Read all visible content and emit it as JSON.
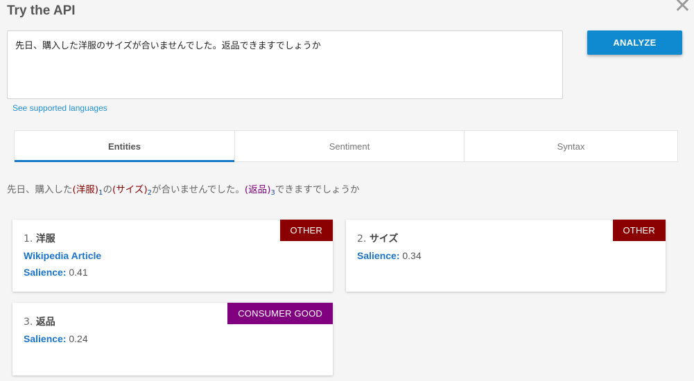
{
  "dialog": {
    "title": "Try the API",
    "close_symbol": "✕"
  },
  "input": {
    "text": "先日、購入した洋服のサイズが合いませんでした。返品できますでしょうか"
  },
  "toolbar": {
    "analyze_label": "ANALYZE"
  },
  "links": {
    "languages": "See supported languages"
  },
  "tabs": [
    {
      "label": "Entities",
      "active": true
    },
    {
      "label": "Sentiment",
      "active": false
    },
    {
      "label": "Syntax",
      "active": false
    }
  ],
  "annotated_text": {
    "p1": "先日、購入した",
    "e1_open": "(",
    "e1": "洋服",
    "e1_close": ")",
    "e1_sub": "1",
    "p2": "の",
    "e2_open": "(",
    "e2": "サイズ",
    "e2_close": ")",
    "e2_sub": "2",
    "p3": "が合いませんでした。",
    "e3_open": "(",
    "e3": "返品",
    "e3_close": ")",
    "e3_sub": "3",
    "p4": "できますでしょうか"
  },
  "entities": [
    {
      "num": "1.",
      "name": "洋服",
      "type": "OTHER",
      "wiki": "Wikipedia Article",
      "salience_label": "Salience:",
      "salience": "0.41"
    },
    {
      "num": "2.",
      "name": "サイズ",
      "type": "OTHER",
      "salience_label": "Salience:",
      "salience": "0.34"
    },
    {
      "num": "3.",
      "name": "返品",
      "type": "CONSUMER GOOD",
      "salience_label": "Salience:",
      "salience": "0.24"
    }
  ],
  "colors": {
    "accent": "#0f8ad1",
    "tab_underline": "#1678c9",
    "link": "#1a73c8",
    "type_other": "#8b0000",
    "type_consumer_good": "#800080"
  },
  "icons": {
    "close": "close-icon"
  }
}
